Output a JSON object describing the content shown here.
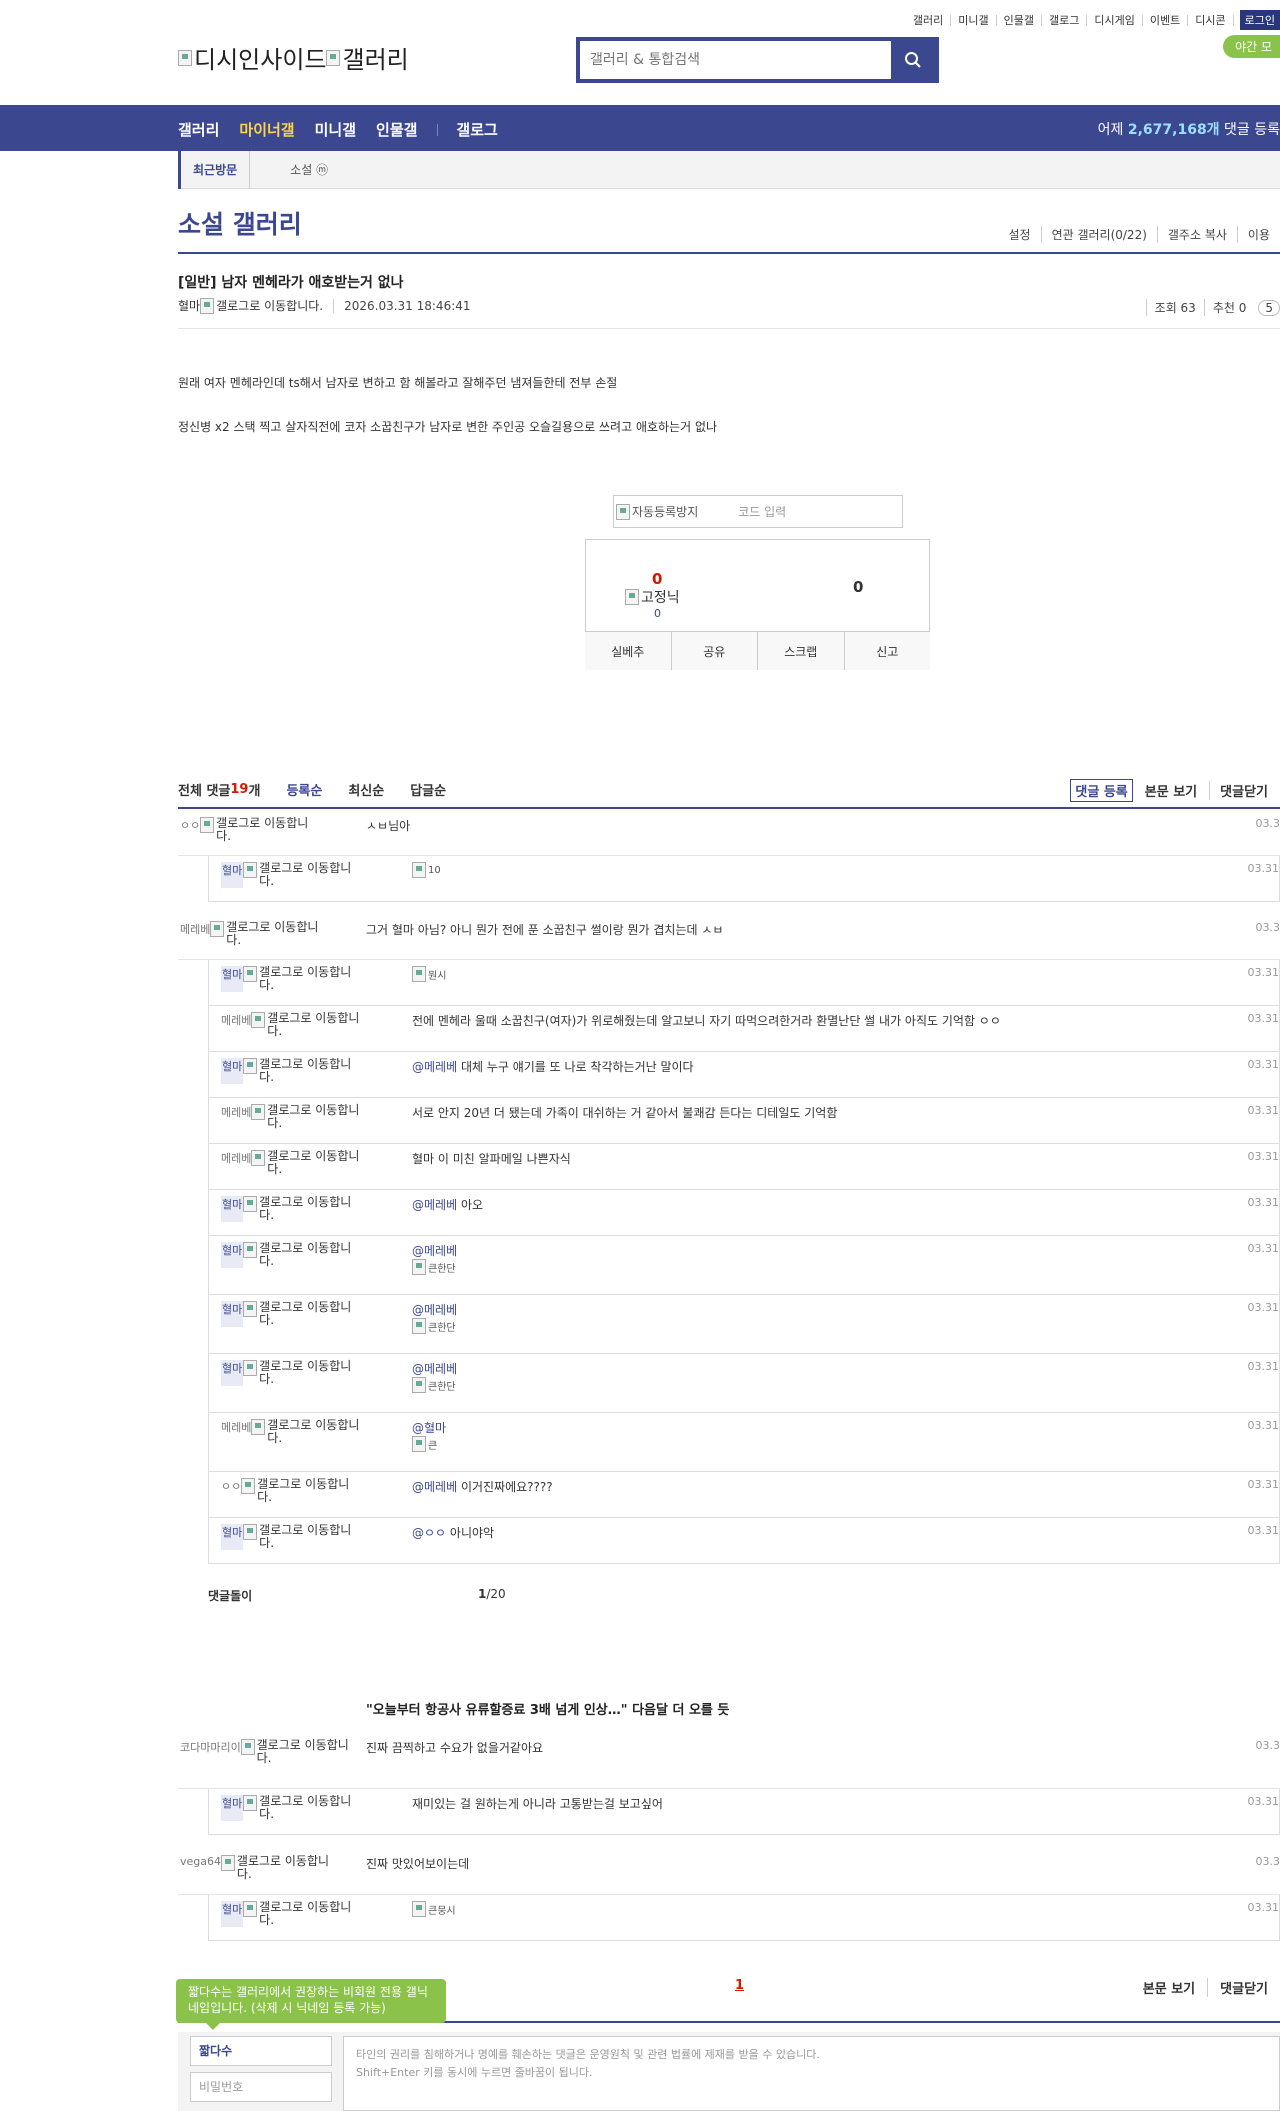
{
  "toplinks": [
    "갤러리",
    "미니갤",
    "인물갤",
    "갤로그",
    "디시게임",
    "이벤트",
    "디시콘"
  ],
  "login_label": "로그인",
  "night_label": "야간 모",
  "logo_alt": "디시인사이드",
  "logo_alt2": "갤러리",
  "search_placeholder": "갤러리 & 통합검색",
  "nav": {
    "items": [
      "갤러리",
      "마이너갤",
      "미니갤",
      "인물갤"
    ],
    "gallog": "갤로그",
    "right_prefix": "어제 ",
    "right_count": "2,677,168개",
    "right_suffix": " 댓글 등록"
  },
  "subnav": {
    "recent": "최근방문",
    "item": "소설 ⓜ"
  },
  "gallery": {
    "title": "소설 갤러리",
    "menu": [
      "설정",
      "연관 갤러리(0/22)",
      "갤주소 복사",
      "이용"
    ]
  },
  "post": {
    "title": "[일반] 남자 멘헤라가 애호받는거 없나",
    "author": "혈마",
    "author_img": "갤로그로 이동합니다.",
    "date": "2026.03.31 18:46:41",
    "views": "조회 63",
    "recommend": "추천 0",
    "pill": "5",
    "body": [
      "원래 여자 멘헤라인데 ts해서 남자로 변하고 함 해볼라고 잘해주던 냄져들한테 전부 손절",
      "정신병 x2 스택 찍고 살자직전에 코자 소꿉친구가 남자로 변한 주인공 오슬길용으로 쓰려고 애호하는거 없나"
    ]
  },
  "captcha": {
    "img_alt": "자동등록방지",
    "placeholder": "코드 입력"
  },
  "recommend_box": {
    "up": "0",
    "fixed_alt": "고정닉",
    "fixed_count": "0",
    "down": "0",
    "buttons": [
      "실베추",
      "공유",
      "스크랩",
      "신고"
    ]
  },
  "comments_header": {
    "total_label": "전체 댓글 ",
    "total_count": "19",
    "total_unit": "개",
    "sorts": [
      "등록순",
      "최신순",
      "답글순"
    ],
    "register": "댓글 등록",
    "view_body": "본문 보기",
    "close": "댓글닫기"
  },
  "gallog_alt": "갤로그로 이동합니다.",
  "comments": [
    {
      "nick": "ㅇㅇ",
      "text": "ㅅㅂ님아",
      "date": "03.3"
    },
    {
      "nick": "혈마",
      "reply": true,
      "fixed": true,
      "img": "10",
      "date": "03.31"
    },
    {
      "nick": "메레베",
      "text": "그거 혈마 아님? 아니 뭔가 전에 푼 소꿉친구 썰이랑 뭔가 겹치는데 ㅅㅂ",
      "date": "03.3"
    },
    {
      "nick": "혈마",
      "reply": true,
      "fixed": true,
      "img": "뭔시",
      "date": "03.31"
    },
    {
      "nick": "메레베",
      "reply": true,
      "text": "전에 멘헤라 울때 소꿉친구(여자)가 위로해줬는데 알고보니 자기 따먹으려한거라 환멸난단 썰 내가 아직도 기억함 ㅇㅇ",
      "date": "03.31"
    },
    {
      "nick": "혈마",
      "reply": true,
      "fixed": true,
      "at": "@메레베",
      "text": " 대체 누구 얘기를 또 나로 착각하는거난 말이다",
      "date": "03.31"
    },
    {
      "nick": "메레베",
      "reply": true,
      "text": "서로 안지 20년 더 됐는데 가족이 대쉬하는 거 같아서 불쾌감 든다는 디테일도 기억함",
      "date": "03.31"
    },
    {
      "nick": "메레베",
      "reply": true,
      "text": "혈마 이 미친 알파메일 나쁜자식",
      "date": "03.31"
    },
    {
      "nick": "혈마",
      "reply": true,
      "fixed": true,
      "at": "@메레베",
      "text": " 아오",
      "date": "03.31"
    },
    {
      "nick": "혈마",
      "reply": true,
      "fixed": true,
      "at": "@메레베",
      "img": "큰한단",
      "date": "03.31"
    },
    {
      "nick": "혈마",
      "reply": true,
      "fixed": true,
      "at": "@메레베",
      "img": "큰한단",
      "date": "03.31"
    },
    {
      "nick": "혈마",
      "reply": true,
      "fixed": true,
      "at": "@메레베",
      "img": "큰한단",
      "date": "03.31"
    },
    {
      "nick": "메레베",
      "reply": true,
      "at": "@혈마",
      "img": "큰",
      "date": "03.31"
    },
    {
      "nick": "ㅇㅇ",
      "reply": true,
      "at": "@메레베",
      "text": " 이거진짜에요????",
      "date": "03.31"
    },
    {
      "nick": "혈마",
      "reply": true,
      "fixed": true,
      "at": "@ㅇㅇ",
      "text": " 아니야악",
      "date": "03.31"
    }
  ],
  "pager1": {
    "label": "댓글돌이",
    "page": "1",
    "total": "/20"
  },
  "news": "\"오늘부터 항공사 유류할증료 3배 넘게 인상…\" 다음달 더 오를 듯",
  "comments2": [
    {
      "nick": "코다마마리이",
      "text": "진짜 끔찍하고 수요가 없을거같아요",
      "date": "03.3"
    },
    {
      "nick": "혈마",
      "reply": true,
      "fixed": true,
      "text": "재미있는 걸 원하는게 아니라 고통받는걸 보고싶어",
      "date": "03.31"
    },
    {
      "nick": "vega64",
      "text": "진짜 맛있어보이는데",
      "date": "03.3"
    },
    {
      "nick": "혈마",
      "reply": true,
      "fixed": true,
      "img": "큰뭉시",
      "date": "03.31"
    }
  ],
  "pager2": "1",
  "bottom_tools": [
    "본문 보기",
    "댓글닫기"
  ],
  "tooltip": "짧다수는 갤러리에서 권장하는 비회원 전용 갤닉네임입니다. (삭제 시 닉네임 등록 가능)",
  "write": {
    "nick": "짧다수",
    "pw_placeholder": "비밀번호",
    "notice1": "타인의 권리를 침해하거나 명예를 훼손하는 댓글은 운영원칙 및 관련 법률에 제재를 받을 수 있습니다.",
    "notice2": "Shift+Enter 키를 동시에 누르면 줄바꿈이 됩니다."
  }
}
